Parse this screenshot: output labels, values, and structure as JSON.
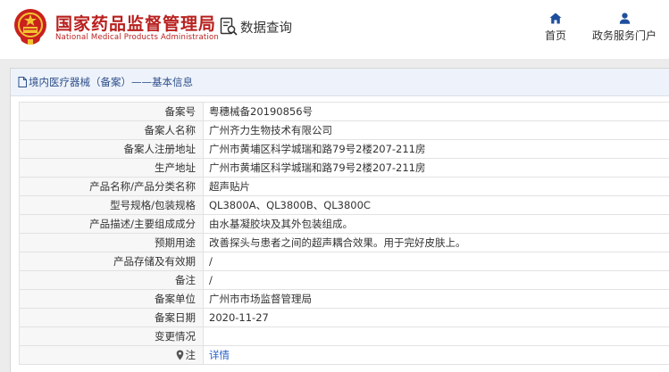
{
  "header": {
    "title": "国家药品监督管理局",
    "subtitle": "National Medical Products Administration",
    "query_label": "数据查询",
    "nav": [
      {
        "label": "首页",
        "icon": "home-icon"
      },
      {
        "label": "政务服务门户",
        "icon": "user-icon"
      }
    ]
  },
  "panel": {
    "title": "境内医疗器械（备案）——基本信息"
  },
  "rows": [
    {
      "key": "备案号",
      "value": "粤穗械备20190856号"
    },
    {
      "key": "备案人名称",
      "value": "广州齐力生物技术有限公司"
    },
    {
      "key": "备案人注册地址",
      "value": "广州市黄埔区科学城瑞和路79号2楼207-211房"
    },
    {
      "key": "生产地址",
      "value": "广州市黄埔区科学城瑞和路79号2楼207-211房"
    },
    {
      "key": "产品名称/产品分类名称",
      "value": "超声贴片"
    },
    {
      "key": "型号规格/包装规格",
      "value": "QL3800A、QL3800B、QL3800C"
    },
    {
      "key": "产品描述/主要组成成分",
      "value": "由水基凝胶块及其外包装组成。"
    },
    {
      "key": "预期用途",
      "value": "改善探头与患者之间的超声耦合效果。用于完好皮肤上。"
    },
    {
      "key": "产品存储及有效期",
      "value": "/"
    },
    {
      "key": "备注",
      "value": "/"
    },
    {
      "key": "备案单位",
      "value": "广州市市场监督管理局"
    },
    {
      "key": "备案日期",
      "value": "2020-11-27"
    },
    {
      "key": "变更情况",
      "value": ""
    }
  ],
  "note_row": {
    "key": "注",
    "value": "详情"
  },
  "colors": {
    "brand_red": "#b8201e",
    "link_blue": "#2a62c9",
    "title_blue": "#2f4f8a"
  }
}
